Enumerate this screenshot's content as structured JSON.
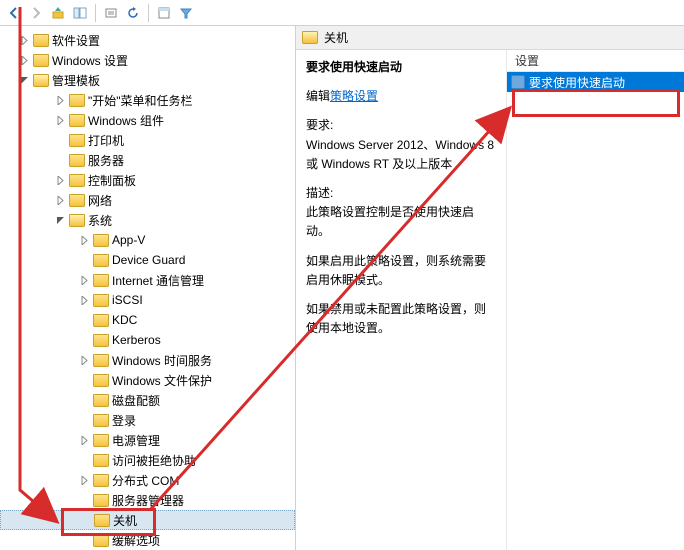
{
  "toolbar": {
    "icons": [
      "back",
      "forward",
      "up",
      "show-hide",
      "export",
      "refresh",
      "help",
      "filter"
    ]
  },
  "tree": {
    "root_items": [
      {
        "label": "软件设置",
        "expander": "collapsed",
        "indent": 1
      },
      {
        "label": "Windows 设置",
        "expander": "collapsed",
        "indent": 1
      },
      {
        "label": "管理模板",
        "expander": "expanded",
        "indent": 1
      }
    ],
    "admin_template_children": [
      {
        "label": "\"开始\"菜单和任务栏",
        "expander": "collapsed",
        "indent": 2
      },
      {
        "label": "Windows 组件",
        "expander": "collapsed",
        "indent": 2
      },
      {
        "label": "打印机",
        "expander": "none",
        "indent": 2
      },
      {
        "label": "服务器",
        "expander": "none",
        "indent": 2
      },
      {
        "label": "控制面板",
        "expander": "collapsed",
        "indent": 2
      },
      {
        "label": "网络",
        "expander": "collapsed",
        "indent": 2
      },
      {
        "label": "系统",
        "expander": "expanded",
        "indent": 2
      }
    ],
    "system_children": [
      {
        "label": "App-V",
        "expander": "collapsed"
      },
      {
        "label": "Device Guard",
        "expander": "none"
      },
      {
        "label": "Internet 通信管理",
        "expander": "collapsed"
      },
      {
        "label": "iSCSI",
        "expander": "collapsed"
      },
      {
        "label": "KDC",
        "expander": "none"
      },
      {
        "label": "Kerberos",
        "expander": "none"
      },
      {
        "label": "Windows 时间服务",
        "expander": "collapsed"
      },
      {
        "label": "Windows 文件保护",
        "expander": "none"
      },
      {
        "label": "磁盘配额",
        "expander": "none"
      },
      {
        "label": "登录",
        "expander": "none"
      },
      {
        "label": "电源管理",
        "expander": "collapsed"
      },
      {
        "label": "访问被拒绝协助",
        "expander": "none"
      },
      {
        "label": "分布式 COM",
        "expander": "collapsed"
      },
      {
        "label": "服务器管理器",
        "expander": "none"
      },
      {
        "label": "关机",
        "expander": "none",
        "selected": true
      },
      {
        "label": "缓解选项",
        "expander": "none"
      }
    ]
  },
  "details": {
    "header_title": "关机",
    "policy_title": "要求使用快速启动",
    "edit_link_prefix": "编辑",
    "edit_link": "策略设置",
    "requirements_label": "要求:",
    "requirements_text": "Windows Server 2012、Windows 8 或 Windows RT 及以上版本",
    "description_label": "描述:",
    "description_text": "此策略设置控制是否使用快速启动。",
    "enabled_text": "如果启用此策略设置，则系统需要启用休眠模式。",
    "disabled_text": "如果禁用或未配置此策略设置，则使用本地设置。",
    "column_header": "设置",
    "items": [
      {
        "label": "要求使用快速启动",
        "selected": true
      }
    ]
  }
}
